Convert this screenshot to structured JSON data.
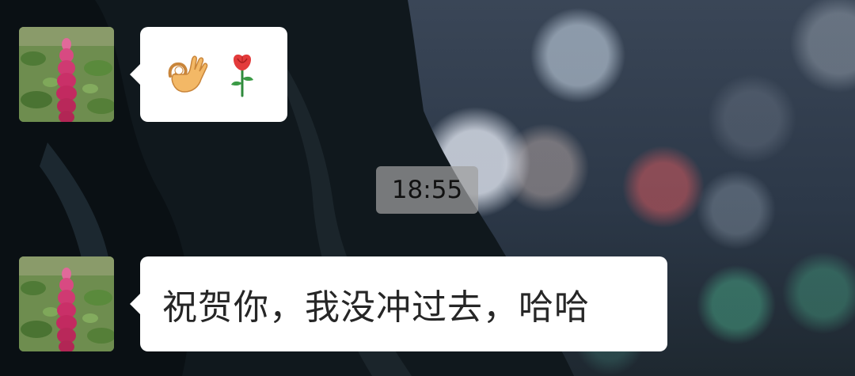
{
  "chat": {
    "messages": [
      {
        "sender_avatar": "lupine-flower-avatar",
        "type": "emoji",
        "emojis": [
          "ok-hand-emoji",
          "rose-emoji"
        ]
      },
      {
        "sender_avatar": "lupine-flower-avatar",
        "type": "text",
        "text": "祝贺你，我没冲过去，哈哈"
      }
    ],
    "timestamp": "18:55"
  },
  "colors": {
    "bubble": "#ffffff",
    "timestamp_bg": "#a0a0a0",
    "text": "#262626"
  }
}
